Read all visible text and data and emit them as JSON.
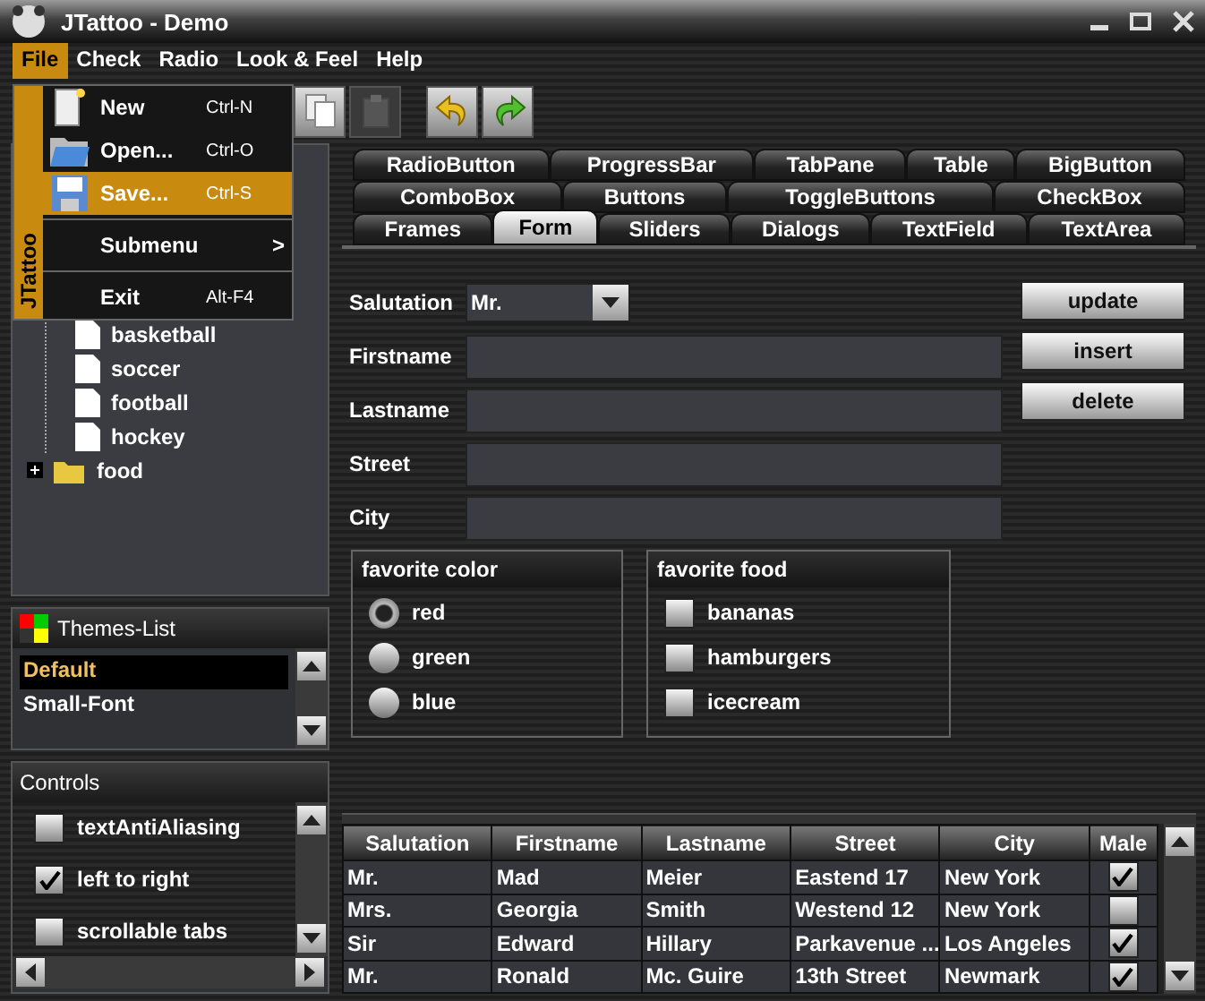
{
  "window": {
    "title": "JTattoo - Demo"
  },
  "menu_bar": [
    {
      "label": "File",
      "selected": true
    },
    {
      "label": "Check",
      "selected": false
    },
    {
      "label": "Radio",
      "selected": false
    },
    {
      "label": "Look & Feel",
      "selected": false
    },
    {
      "label": "Help",
      "selected": false
    }
  ],
  "file_menu": {
    "banner": "JTattoo",
    "items": [
      {
        "kind": "item",
        "label": "New",
        "shortcut": "Ctrl-N",
        "selected": false
      },
      {
        "kind": "item",
        "label": "Open...",
        "shortcut": "Ctrl-O",
        "selected": false
      },
      {
        "kind": "item",
        "label": "Save...",
        "shortcut": "Ctrl-S",
        "selected": true
      },
      {
        "kind": "separator"
      },
      {
        "kind": "submenu",
        "label": "Submenu",
        "arrow": ">",
        "selected": false
      },
      {
        "kind": "separator"
      },
      {
        "kind": "item",
        "label": "Exit",
        "shortcut": "Alt-F4",
        "selected": false
      }
    ]
  },
  "toolbar": [
    {
      "disabled": false
    },
    {
      "disabled": true
    },
    {
      "disabled": false
    },
    {
      "disabled": false
    }
  ],
  "tree": {
    "items": [
      {
        "children": [
          {
            "label": "basketball"
          },
          {
            "label": "soccer"
          },
          {
            "label": "football"
          },
          {
            "label": "hockey"
          }
        ]
      },
      {
        "label": "food",
        "expanded": false
      }
    ]
  },
  "themes_list": {
    "title": "Themes-List",
    "items": [
      {
        "label": "Default",
        "selected": true
      },
      {
        "label": "Small-Font",
        "selected": false
      }
    ]
  },
  "controls": {
    "title": "Controls",
    "items": [
      {
        "label": "textAntiAliasing",
        "checked": false
      },
      {
        "label": "left to right",
        "checked": true
      },
      {
        "label": "scrollable tabs",
        "checked": false
      }
    ]
  },
  "tabs": [
    [
      {
        "label": "RadioButton",
        "selected": false
      },
      {
        "label": "ProgressBar",
        "selected": false
      },
      {
        "label": "TabPane",
        "selected": false
      },
      {
        "label": "Table",
        "selected": false
      },
      {
        "label": "BigButton",
        "selected": false
      }
    ],
    [
      {
        "label": "ComboBox",
        "selected": false
      },
      {
        "label": "Buttons",
        "selected": false
      },
      {
        "label": "ToggleButtons",
        "selected": false
      },
      {
        "label": "CheckBox",
        "selected": false
      }
    ],
    [
      {
        "label": "Frames",
        "selected": false
      },
      {
        "label": "Form",
        "selected": true
      },
      {
        "label": "Sliders",
        "selected": false
      },
      {
        "label": "Dialogs",
        "selected": false
      },
      {
        "label": "TextField",
        "selected": false
      },
      {
        "label": "TextArea",
        "selected": false
      }
    ]
  ],
  "form": {
    "fields": [
      {
        "label": "Salutation",
        "kind": "combo",
        "value": "Mr."
      },
      {
        "label": "Firstname",
        "kind": "text"
      },
      {
        "label": "Lastname",
        "kind": "text"
      },
      {
        "label": "Street",
        "kind": "text"
      },
      {
        "label": "City",
        "kind": "text"
      }
    ],
    "buttons": [
      "update",
      "insert",
      "delete"
    ],
    "groups": [
      {
        "title": "favorite color",
        "kind": "radio",
        "options": [
          {
            "label": "red",
            "selected": true
          },
          {
            "label": "green",
            "selected": false
          },
          {
            "label": "blue",
            "selected": false
          }
        ]
      },
      {
        "title": "favorite food",
        "kind": "checkbox",
        "options": [
          {
            "label": "bananas",
            "checked": false
          },
          {
            "label": "hamburgers",
            "checked": false
          },
          {
            "label": "icecream",
            "checked": false
          }
        ]
      }
    ]
  },
  "table": {
    "columns": [
      "Salutation",
      "Firstname",
      "Lastname",
      "Street",
      "City",
      "Male"
    ],
    "rows": [
      {
        "cells": [
          "Mr.",
          "Mad",
          "Meier",
          "Eastend 17",
          "New York"
        ],
        "male": true
      },
      {
        "cells": [
          "Mrs.",
          "Georgia",
          "Smith",
          "Westend 12",
          "New York"
        ],
        "male": false
      },
      {
        "cells": [
          "Sir",
          "Edward",
          "Hillary",
          "Parkavenue ...",
          "Los Angeles"
        ],
        "male": true
      },
      {
        "cells": [
          "Mr.",
          "Ronald",
          "Mc. Guire",
          "13th Street",
          "Newmark"
        ],
        "male": true
      }
    ]
  }
}
